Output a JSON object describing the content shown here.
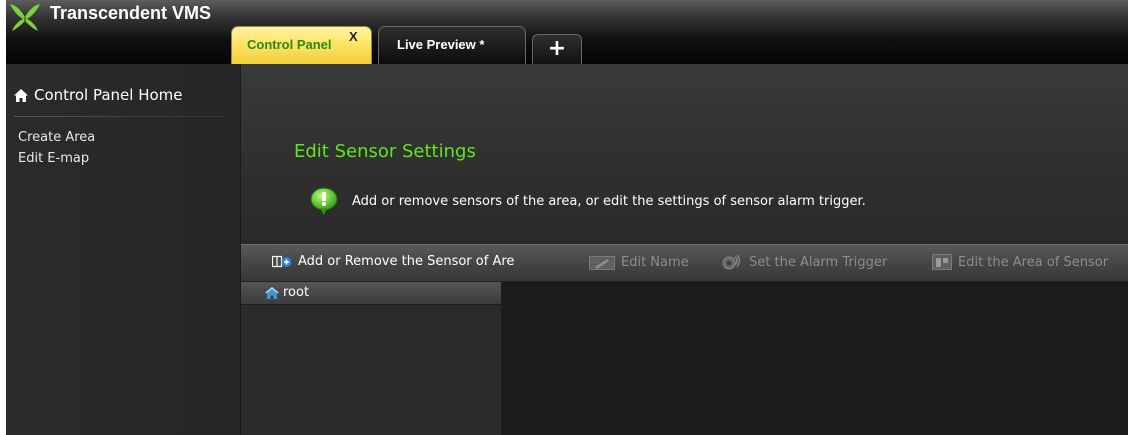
{
  "app": {
    "title": "Transcendent VMS"
  },
  "tabs": {
    "control_panel": {
      "label": "Control Panel",
      "close": "X"
    },
    "live_preview": {
      "label": "Live Preview *"
    },
    "add": "+"
  },
  "sidebar": {
    "home": "Control Panel Home",
    "items": [
      {
        "label": "Create Area"
      },
      {
        "label": "Edit E-map"
      }
    ]
  },
  "main": {
    "title": "Edit Sensor Settings",
    "description": "Add or remove sensors of the area, or edit the settings of sensor alarm trigger."
  },
  "toolbar": {
    "add_remove": "Add or Remove the Sensor of Are",
    "edit_name": "Edit Name",
    "set_alarm": "Set the Alarm Trigger",
    "edit_area": "Edit the Area of Sensor"
  },
  "tree": {
    "root": "root"
  },
  "colors": {
    "accent_green": "#5ee61a",
    "tab_active": "#ffe66a",
    "toolbar_disabled_text": "#8d8d8d"
  },
  "icons": {
    "logo": "leaf-logo-icon",
    "home": "home-icon",
    "info": "info-bubble-icon",
    "add_remove": "sensor-add-icon",
    "edit_name": "edit-name-icon",
    "set_alarm": "alarm-trigger-icon",
    "edit_area": "area-icon",
    "tree_root": "home-icon"
  }
}
